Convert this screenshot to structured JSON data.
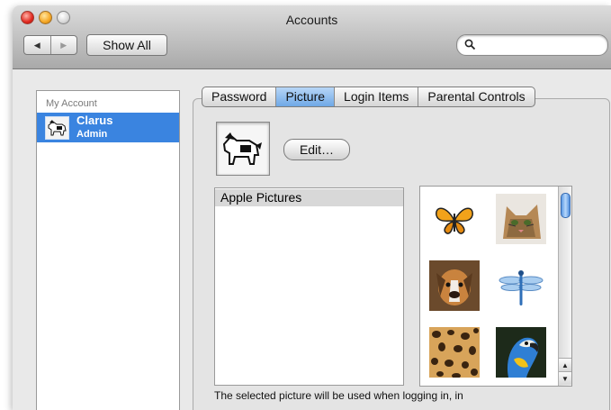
{
  "window": {
    "title": "Accounts"
  },
  "toolbar": {
    "back_icon": "back-arrow-icon",
    "forward_icon": "forward-arrow-icon",
    "show_all_label": "Show All",
    "search": {
      "value": "",
      "placeholder": ""
    }
  },
  "sidebar": {
    "header": "My Account",
    "accounts": [
      {
        "name": "Clarus",
        "role": "Admin",
        "avatar": "dog-icon",
        "selected": true
      }
    ]
  },
  "tabs": [
    {
      "label": "Password",
      "selected": false
    },
    {
      "label": "Picture",
      "selected": true
    },
    {
      "label": "Login Items",
      "selected": false
    },
    {
      "label": "Parental Controls",
      "selected": false
    }
  ],
  "picture": {
    "current": "dog-icon",
    "edit_label": "Edit…",
    "sources": [
      {
        "label": "Apple Pictures",
        "selected": true
      }
    ],
    "grid": [
      "butterfly",
      "cat",
      "dog",
      "dragonfly",
      "leopard-print",
      "parrot"
    ],
    "caption": "The selected picture will be used when logging in, in"
  },
  "colors": {
    "selection": "#3a84e0",
    "tab_selected": "#8bbcf0"
  }
}
